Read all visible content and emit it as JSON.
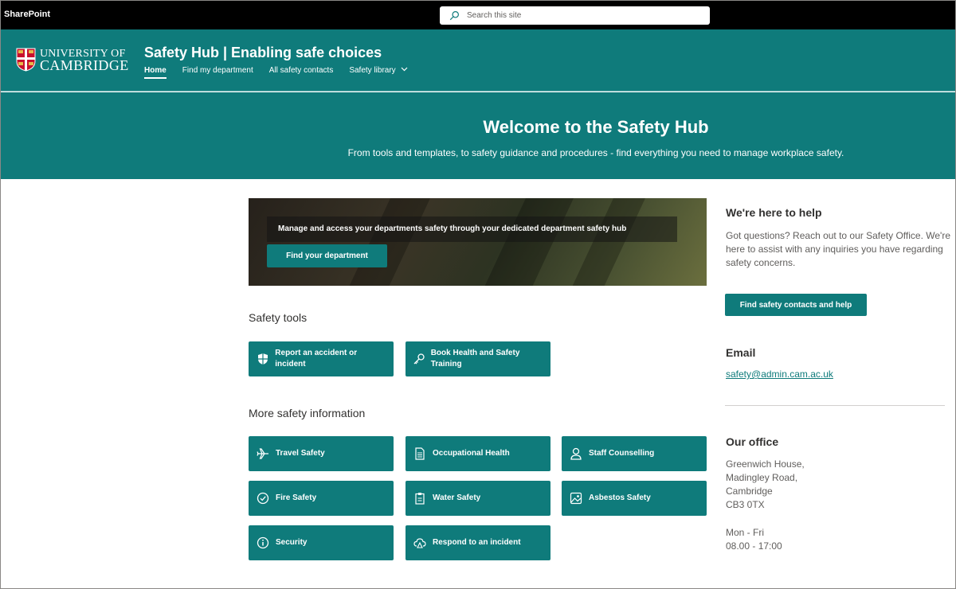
{
  "suitebar": {
    "brand": "SharePoint",
    "search_placeholder": "Search this site"
  },
  "header": {
    "logo_line1": "UNIVERSITY OF",
    "logo_line2": "CAMBRIDGE",
    "site_title": "Safety Hub | Enabling safe choices",
    "nav": [
      {
        "label": "Home",
        "active": true
      },
      {
        "label": "Find my department"
      },
      {
        "label": "All safety contacts"
      },
      {
        "label": "Safety library",
        "has_dropdown": true
      }
    ]
  },
  "hero": {
    "title": "Welcome to the Safety Hub",
    "subtitle": "From tools and templates, to safety guidance and procedures - find everything you need to manage workplace safety."
  },
  "banner": {
    "text": "Manage and access your departments safety through your dedicated department safety hub",
    "button": "Find your department"
  },
  "safety_tools": {
    "heading": "Safety tools",
    "tiles": [
      {
        "label": "Report an accident or incident",
        "icon": "shield-icon"
      },
      {
        "label": "Book Health and Safety Training",
        "icon": "key-icon"
      }
    ]
  },
  "more_info": {
    "heading": "More safety information",
    "tiles": [
      {
        "label": "Travel Safety",
        "icon": "airplane-icon"
      },
      {
        "label": "Occupational Health",
        "icon": "document-icon"
      },
      {
        "label": "Staff Counselling",
        "icon": "person-icon"
      },
      {
        "label": "Fire Safety",
        "icon": "check-circle-icon"
      },
      {
        "label": "Water Safety",
        "icon": "clipboard-icon"
      },
      {
        "label": "Asbestos Safety",
        "icon": "image-icon"
      },
      {
        "label": "Security",
        "icon": "info-icon"
      },
      {
        "label": "Respond to an incident",
        "icon": "cloud-alert-icon"
      }
    ]
  },
  "help": {
    "heading": "We're here to help",
    "text": "Got questions? Reach out to our Safety Office. We're here to assist with any inquiries you have regarding safety concerns.",
    "button": "Find safety contacts and help"
  },
  "email": {
    "heading": "Email",
    "address": "safety@admin.cam.ac.uk"
  },
  "office": {
    "heading": "Our office",
    "address_lines": [
      "Greenwich House,",
      "Madingley Road,",
      "Cambridge",
      "CB3 0TX"
    ],
    "hours_line1": "Mon - Fri",
    "hours_line2": "08.00 - 17:00"
  },
  "colors": {
    "brand_teal": "#0f7b7b",
    "suitebar": "#000000"
  }
}
